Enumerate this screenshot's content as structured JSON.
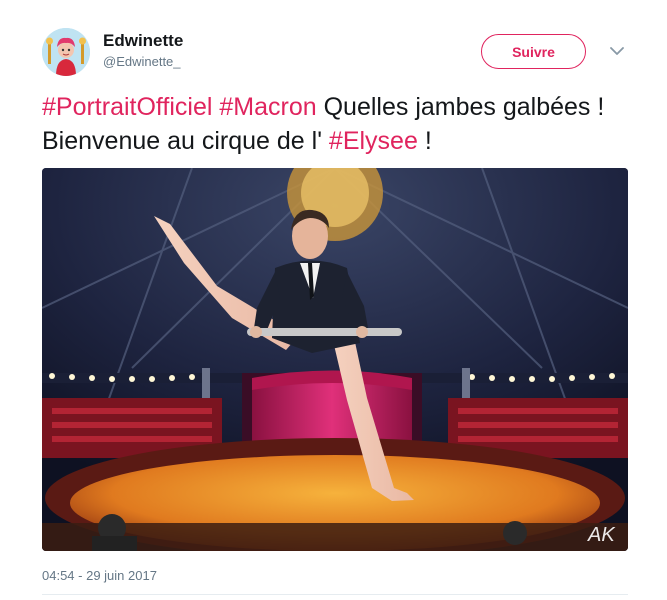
{
  "user": {
    "name": "Edwinette",
    "handle": "@Edwinette_"
  },
  "actions": {
    "follow_label": "Suivre",
    "more_icon": "chevron-down-icon"
  },
  "tweet": {
    "hashtag_1": "#PortraitOfficiel",
    "hashtag_2": "#Macron",
    "text_1": "  Quelles jambes galbées ! Bienvenue au cirque de l' ",
    "hashtag_3": "#Elysee",
    "text_2": " !",
    "timestamp": "04:54 - 29 juin 2017"
  },
  "media": {
    "watermark": "AK"
  },
  "colors": {
    "accent": "#e0245e",
    "secondary_text": "#657786",
    "primary_text": "#14171a"
  }
}
